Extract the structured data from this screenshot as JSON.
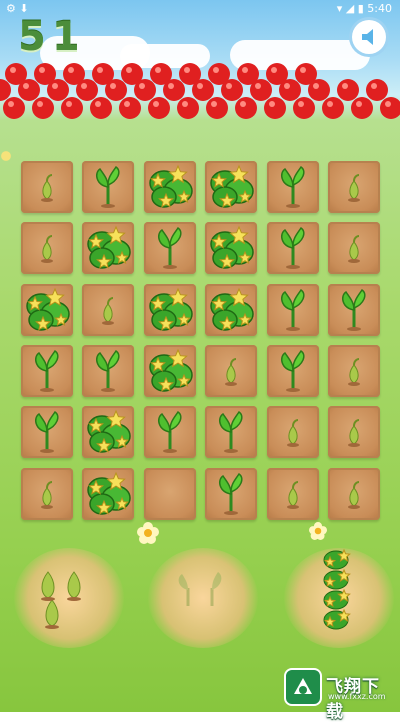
{
  "status_bar": {
    "time": "5:40",
    "left_icons": [
      "settings-icon",
      "download-icon"
    ],
    "right_icons": [
      "wifi-icon",
      "signal-icon",
      "battery-icon"
    ]
  },
  "game": {
    "score": "51",
    "sound": "sound-on-icon",
    "grid": [
      [
        "sprout",
        "plant",
        "flower_bush",
        "flower_bush",
        "plant",
        "sprout"
      ],
      [
        "sprout",
        "flower_bush",
        "plant",
        "flower_bush",
        "plant",
        "sprout"
      ],
      [
        "flower_bush",
        "sprout",
        "flower_bush",
        "flower_bush",
        "plant",
        "plant"
      ],
      [
        "plant",
        "plant",
        "flower_bush",
        "sprout",
        "plant",
        "sprout"
      ],
      [
        "plant",
        "flower_bush",
        "plant",
        "plant",
        "sprout",
        "sprout"
      ],
      [
        "sprout",
        "flower_bush",
        "empty",
        "plant",
        "sprout",
        "sprout"
      ]
    ],
    "slots": [
      {
        "name": "sprout-cluster",
        "item": "sprouts"
      },
      {
        "name": "empty-slot",
        "item": "faded plants"
      },
      {
        "name": "flower-stack",
        "item": "flower_bush_stack"
      }
    ]
  },
  "watermark": {
    "title": "飞翔下载",
    "subtitle": "www.fxxz.com"
  },
  "colors": {
    "tile": "#c98d58",
    "score": "#4b8d3a",
    "apple": "#e02020",
    "grass": "#95cf4e"
  }
}
